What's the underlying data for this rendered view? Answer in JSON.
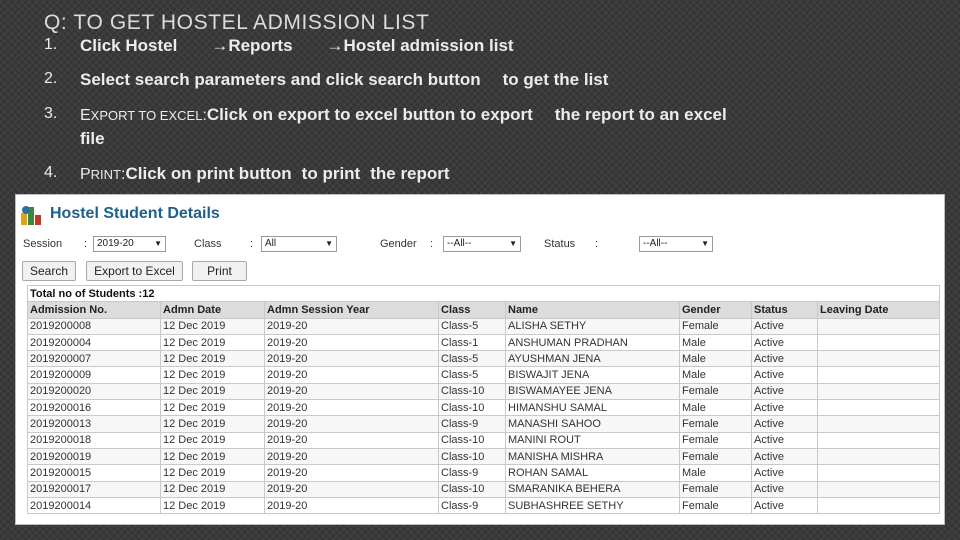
{
  "slide": {
    "title": "Q: TO GET HOSTEL ADMISSION LIST",
    "steps": [
      {
        "num": "1.",
        "parts": [
          "Click Hostel",
          "Reports",
          "Hostel admission list"
        ]
      },
      {
        "num": "2.",
        "text": "Select search parameters and click search button",
        "text2": "to get the list"
      },
      {
        "num": "3.",
        "lead_first": "E",
        "lead_rest": "XPORT TO EXCEL",
        "lead_sep": ":",
        "text": "Click on export to excel button to export",
        "text2": "the report to an excel",
        "text3": "file"
      },
      {
        "num": "4.",
        "lead_first": "P",
        "lead_rest": "RINT",
        "lead_sep": ":",
        "text": "Click on print button",
        "text2": "to print",
        "text3": "the report"
      }
    ],
    "arrow": "→"
  },
  "panel": {
    "title": "Hostel Student Details",
    "filters": {
      "session_label": "Session",
      "session_value": "2019-20",
      "class_label": "Class",
      "class_value": "All",
      "gender_label": "Gender",
      "gender_value": "--All--",
      "status_label": "Status",
      "status_value": "--All--",
      "colon": ":"
    },
    "buttons": {
      "search": "Search",
      "export": "Export to Excel",
      "print": "Print"
    },
    "table": {
      "total": "Total no of Students :12",
      "columns": [
        "Admission No.",
        "Admn Date",
        "Admn Session Year",
        "Class",
        "Name",
        "Gender",
        "Status",
        "Leaving Date"
      ],
      "rows": [
        [
          "2019200008",
          "12 Dec 2019",
          "2019-20",
          "Class-5",
          "ALISHA SETHY",
          "Female",
          "Active",
          ""
        ],
        [
          "2019200004",
          "12 Dec 2019",
          "2019-20",
          "Class-1",
          "ANSHUMAN PRADHAN",
          "Male",
          "Active",
          ""
        ],
        [
          "2019200007",
          "12 Dec 2019",
          "2019-20",
          "Class-5",
          "AYUSHMAN JENA",
          "Male",
          "Active",
          ""
        ],
        [
          "2019200009",
          "12 Dec 2019",
          "2019-20",
          "Class-5",
          "BISWAJIT JENA",
          "Male",
          "Active",
          ""
        ],
        [
          "2019200020",
          "12 Dec 2019",
          "2019-20",
          "Class-10",
          "BISWAMAYEE JENA",
          "Female",
          "Active",
          ""
        ],
        [
          "2019200016",
          "12 Dec 2019",
          "2019-20",
          "Class-10",
          "HIMANSHU SAMAL",
          "Male",
          "Active",
          ""
        ],
        [
          "2019200013",
          "12 Dec 2019",
          "2019-20",
          "Class-9",
          "MANASHI SAHOO",
          "Female",
          "Active",
          ""
        ],
        [
          "2019200018",
          "12 Dec 2019",
          "2019-20",
          "Class-10",
          "MANINI ROUT",
          "Female",
          "Active",
          ""
        ],
        [
          "2019200019",
          "12 Dec 2019",
          "2019-20",
          "Class-10",
          "MANISHA MISHRA",
          "Female",
          "Active",
          ""
        ],
        [
          "2019200015",
          "12 Dec 2019",
          "2019-20",
          "Class-9",
          "ROHAN SAMAL",
          "Male",
          "Active",
          ""
        ],
        [
          "2019200017",
          "12 Dec 2019",
          "2019-20",
          "Class-10",
          "SMARANIKA BEHERA",
          "Female",
          "Active",
          ""
        ],
        [
          "2019200014",
          "12 Dec 2019",
          "2019-20",
          "Class-9",
          "SUBHASHREE SETHY",
          "Female",
          "Active",
          ""
        ]
      ]
    }
  },
  "colors": {
    "slide_bg": "#3a3a3a",
    "title_blue": "#1f5f8b",
    "header_gray": "#dcdcdc"
  }
}
